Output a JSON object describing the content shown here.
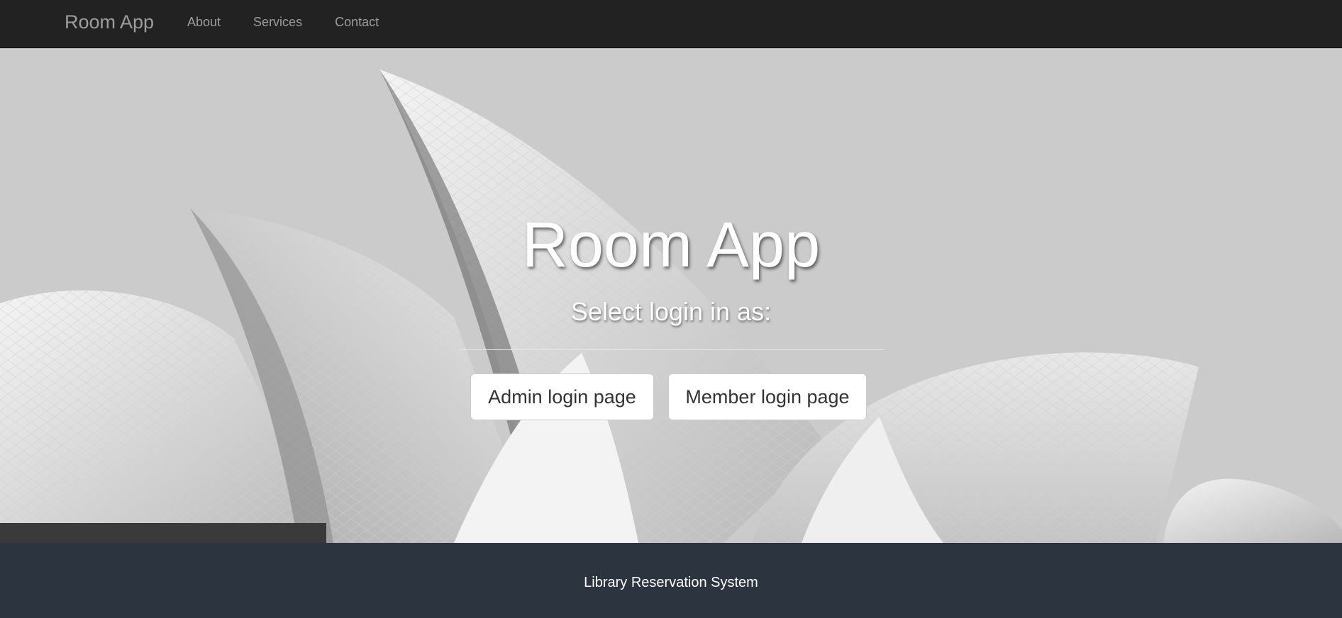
{
  "navbar": {
    "brand": "Room App",
    "links": [
      "About",
      "Services",
      "Contact"
    ]
  },
  "hero": {
    "title": "Room App",
    "subtitle": "Select login in as:",
    "buttons": {
      "admin": "Admin login page",
      "member": "Member login page"
    }
  },
  "footer": {
    "text": "Library Reservation System"
  },
  "colors": {
    "navbar_bg": "#222222",
    "nav_text": "#9d9d9d",
    "footer_bg": "#2c3440",
    "button_bg": "#ffffff"
  },
  "background_image": "opera-house-sails-grayscale"
}
